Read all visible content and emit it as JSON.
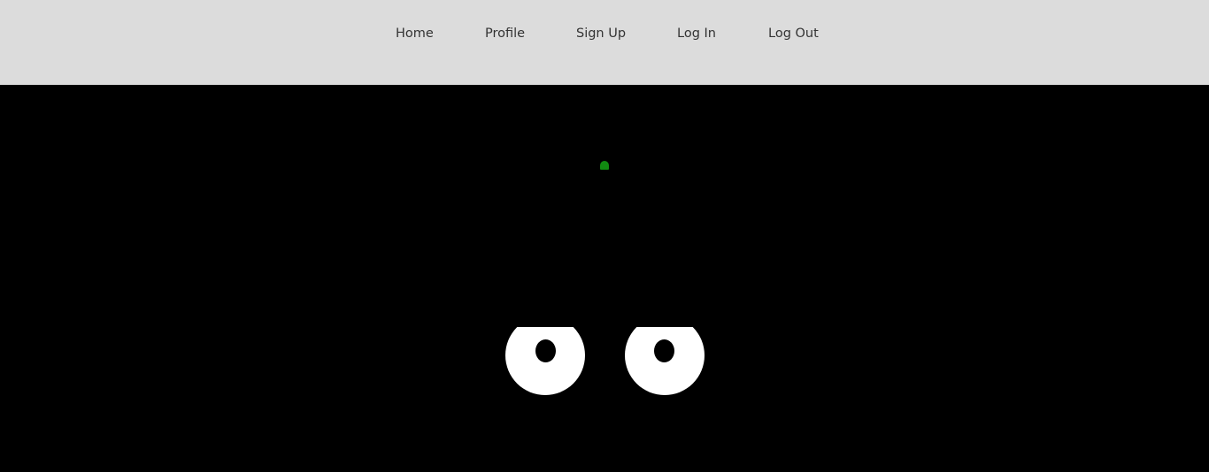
{
  "nav": {
    "items": [
      {
        "label": "Home"
      },
      {
        "label": "Profile"
      },
      {
        "label": "Sign Up"
      },
      {
        "label": "Log In"
      },
      {
        "label": "Log Out"
      }
    ]
  },
  "colors": {
    "nav_background": "#dcdcdc",
    "nav_text": "#333333",
    "scene_background": "#000000",
    "dot": "#118a11",
    "eye_white": "#ffffff",
    "pupil": "#000000"
  },
  "icons": [
    "green-dot-icon",
    "eye-icon",
    "pupil-icon"
  ]
}
